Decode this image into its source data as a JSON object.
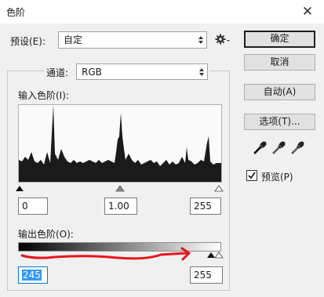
{
  "window": {
    "title": "色阶",
    "close_glyph": "✕"
  },
  "preset": {
    "label": "预设(E):",
    "value": "自定"
  },
  "channel": {
    "label": "通道:",
    "value": "RGB"
  },
  "input_levels": {
    "label": "输入色阶(I):",
    "black": "0",
    "gamma": "1.00",
    "white": "255"
  },
  "output_levels": {
    "label": "输出色阶(O):",
    "black": "245",
    "white": "255"
  },
  "buttons": {
    "ok": "确定",
    "cancel": "取消",
    "auto": "自动(A)",
    "options": "选项(T)..."
  },
  "preview": {
    "label": "预览(P)",
    "checked": true
  },
  "icons": {
    "gear": "gear-icon",
    "black_eyedropper": "black-eyedropper-icon",
    "gray_eyedropper": "gray-eyedropper-icon",
    "white_eyedropper": "white-eyedropper-icon"
  },
  "annotation_color": "#e8141c"
}
